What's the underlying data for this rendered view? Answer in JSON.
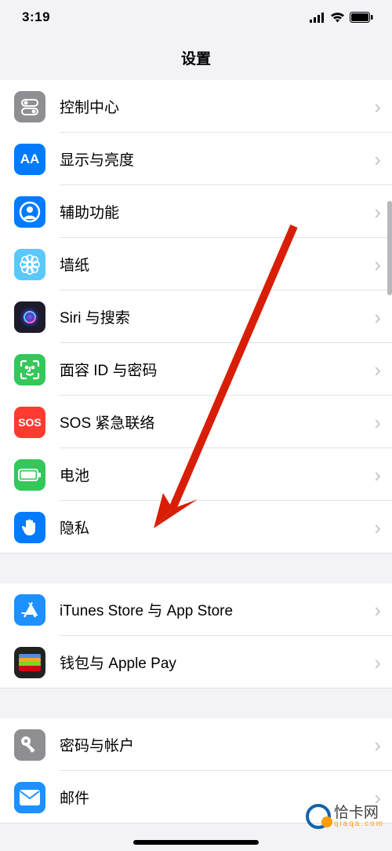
{
  "status": {
    "time": "3:19"
  },
  "header": {
    "title": "设置"
  },
  "groups": [
    {
      "rows": [
        {
          "id": "control-center",
          "label": "控制中心",
          "icon": "switches",
          "bg": "#8e8e93"
        },
        {
          "id": "display",
          "label": "显示与亮度",
          "icon": "AA",
          "bg": "#007aff"
        },
        {
          "id": "accessibility",
          "label": "辅助功能",
          "icon": "person-circle",
          "bg": "#007aff"
        },
        {
          "id": "wallpaper",
          "label": "墙纸",
          "icon": "flower",
          "bg": "#5ac8fa"
        },
        {
          "id": "siri",
          "label": "Siri 与搜索",
          "icon": "siri",
          "bg": "#1b1b2b"
        },
        {
          "id": "faceid",
          "label": "面容 ID 与密码",
          "icon": "faceid",
          "bg": "#34c759"
        },
        {
          "id": "sos",
          "label": "SOS 紧急联络",
          "icon": "SOS",
          "bg": "#ff3b30"
        },
        {
          "id": "battery",
          "label": "电池",
          "icon": "battery",
          "bg": "#34c759"
        },
        {
          "id": "privacy",
          "label": "隐私",
          "icon": "hand",
          "bg": "#007aff"
        }
      ]
    },
    {
      "rows": [
        {
          "id": "itunes",
          "label": "iTunes Store 与 App Store",
          "icon": "appstore",
          "bg": "#1e90ff"
        },
        {
          "id": "wallet",
          "label": "钱包与 Apple Pay",
          "icon": "wallet",
          "bg": "#222"
        }
      ]
    },
    {
      "rows": [
        {
          "id": "passwords",
          "label": "密码与帐户",
          "icon": "key",
          "bg": "#8e8e93"
        },
        {
          "id": "mail",
          "label": "邮件",
          "icon": "mail",
          "bg": "#1e90ff"
        }
      ]
    }
  ],
  "watermark": {
    "main": "恰卡网",
    "sub": "qiaqa.com"
  }
}
